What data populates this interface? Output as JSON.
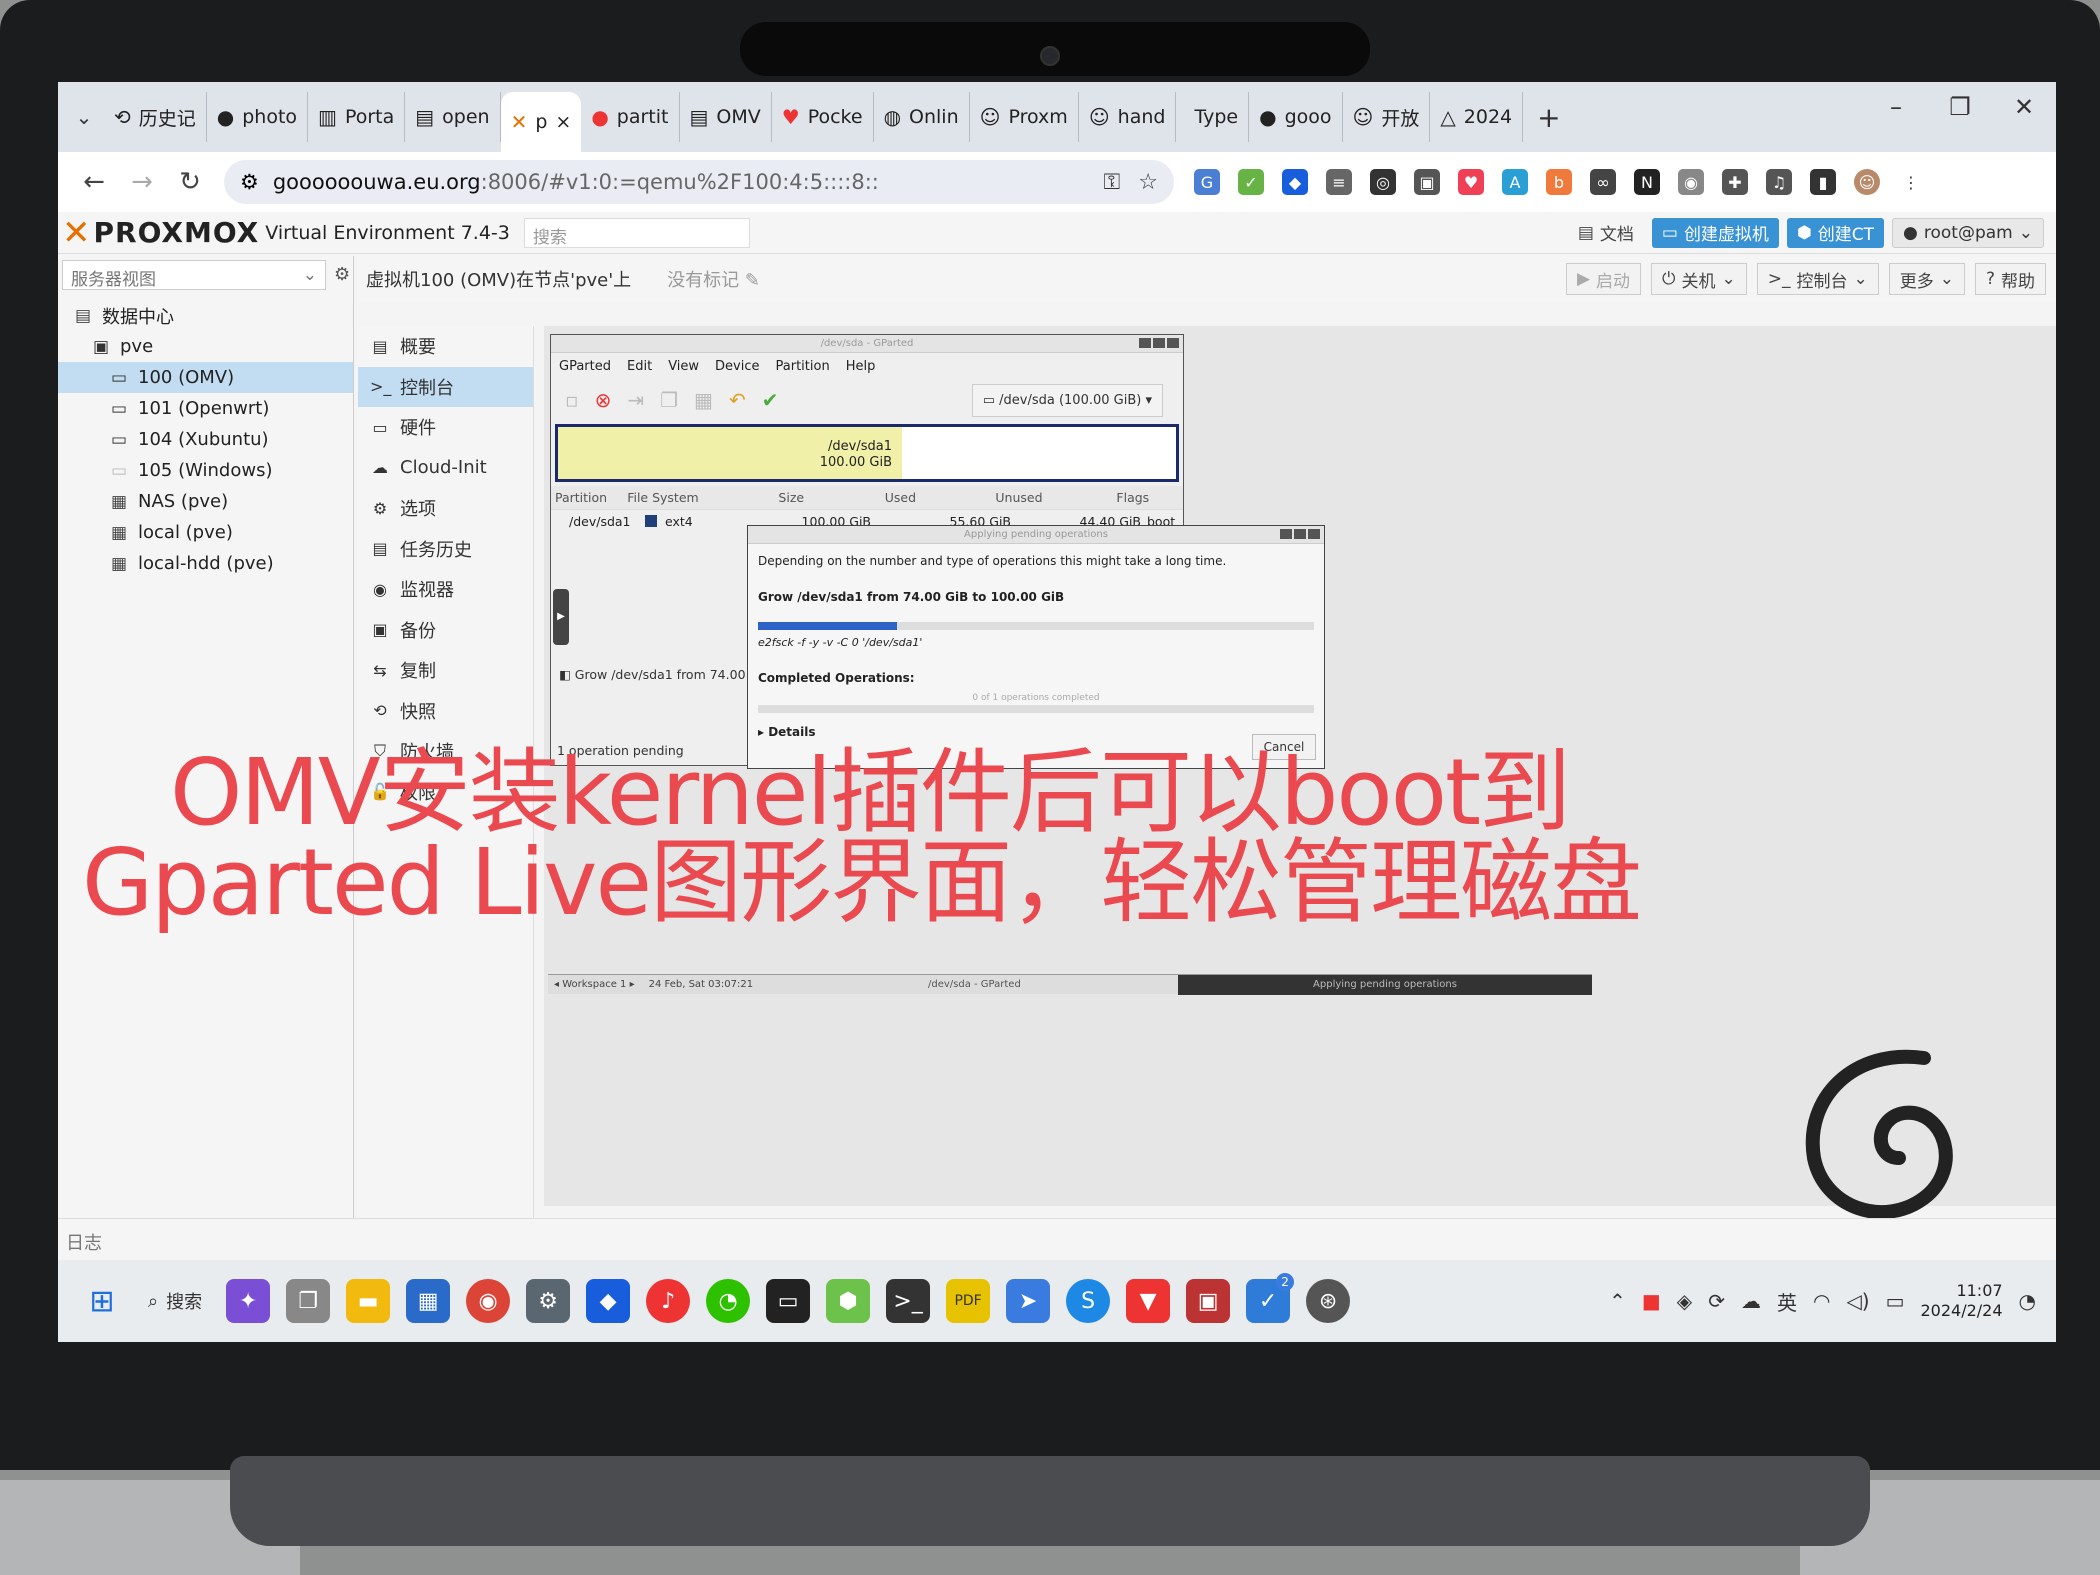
{
  "browser": {
    "tabs": [
      {
        "icon": "history-icon",
        "label": "历史记"
      },
      {
        "icon": "github-icon",
        "label": "photo"
      },
      {
        "icon": "portainer-icon",
        "label": "Porta"
      },
      {
        "icon": "doc-icon",
        "label": "open"
      },
      {
        "icon": "proxmox-icon",
        "label": "p",
        "active": true
      },
      {
        "icon": "ask-icon",
        "label": "partit"
      },
      {
        "icon": "doc-icon",
        "label": "OMV"
      },
      {
        "icon": "pocket-icon",
        "label": "Pocke"
      },
      {
        "icon": "globe-icon",
        "label": "Onlin"
      },
      {
        "icon": "avatar-icon",
        "label": "Proxm"
      },
      {
        "icon": "avatar-icon",
        "label": "hand"
      },
      {
        "icon": "blank-icon",
        "label": "Type"
      },
      {
        "icon": "github-icon",
        "label": "gooo"
      },
      {
        "icon": "avatar-icon",
        "label": "开放"
      },
      {
        "icon": "triangle-icon",
        "label": "2024"
      }
    ],
    "tab_close": "×",
    "new_tab": "+",
    "url_host": "goooooouwa.eu.org",
    "url_rest": ":8006/#v1:0:=qemu%2F100:4:5::::8::"
  },
  "pve": {
    "logo": "PROXMOX",
    "version": "Virtual Environment 7.4-3",
    "search_placeholder": "搜索",
    "header_buttons": {
      "docs": "文档",
      "create_vm": "创建虚拟机",
      "create_ct": "创建CT",
      "user": "root@pam"
    },
    "view_selector": "服务器视图",
    "tree": [
      {
        "label": "数据中心",
        "level": 0,
        "icon": "datacenter-icon"
      },
      {
        "label": "pve",
        "level": 1,
        "icon": "node-icon"
      },
      {
        "label": "100 (OMV)",
        "level": 2,
        "icon": "vm-icon",
        "selected": true
      },
      {
        "label": "101 (Openwrt)",
        "level": 2,
        "icon": "vm-icon"
      },
      {
        "label": "104 (Xubuntu)",
        "level": 2,
        "icon": "vm-icon"
      },
      {
        "label": "105 (Windows)",
        "level": 2,
        "icon": "vm-off-icon"
      },
      {
        "label": "NAS (pve)",
        "level": 2,
        "icon": "storage-icon"
      },
      {
        "label": "local (pve)",
        "level": 2,
        "icon": "storage-icon"
      },
      {
        "label": "local-hdd (pve)",
        "level": 2,
        "icon": "storage-icon"
      }
    ],
    "vm_title": "虚拟机100 (OMV)在节点'pve'上",
    "tag_placeholder": "没有标记",
    "vm_buttons": {
      "start": "启动",
      "shutdown": "关机",
      "console": "控制台",
      "more": "更多",
      "help": "帮助"
    },
    "vm_nav": [
      {
        "label": "概要",
        "icon": "summary-icon"
      },
      {
        "label": "控制台",
        "icon": "console-icon",
        "selected": true
      },
      {
        "label": "硬件",
        "icon": "hardware-icon"
      },
      {
        "label": "Cloud-Init",
        "icon": "cloud-icon"
      },
      {
        "label": "选项",
        "icon": "options-icon"
      },
      {
        "label": "任务历史",
        "icon": "task-icon"
      },
      {
        "label": "监视器",
        "icon": "monitor-icon"
      },
      {
        "label": "备份",
        "icon": "backup-icon"
      },
      {
        "label": "复制",
        "icon": "replication-icon"
      },
      {
        "label": "快照",
        "icon": "snapshot-icon"
      },
      {
        "label": "防火墙",
        "icon": "firewall-icon"
      },
      {
        "label": "权限",
        "icon": "permissions-icon"
      }
    ],
    "log_label": "日志"
  },
  "gparted": {
    "title": "/dev/sda - GParted",
    "menu": [
      "GParted",
      "Edit",
      "View",
      "Device",
      "Partition",
      "Help"
    ],
    "device": "/dev/sda (100.00 GiB)",
    "map_label": "/dev/sda1",
    "map_size": "100.00 GiB",
    "columns": [
      "Partition",
      "File System",
      "Size",
      "Used",
      "Unused",
      "Flags"
    ],
    "row": {
      "partition": "/dev/sda1",
      "fs": "ext4",
      "size": "100.00 GiB",
      "used": "55.60 GiB",
      "unused": "44.40 GiB",
      "flags": "boot"
    },
    "pending_op": "Grow /dev/sda1 from 74.00 GiB to",
    "status": "1 operation pending",
    "dialog": {
      "title": "Applying pending operations",
      "intro": "Depending on the number and type of operations this might take a long time.",
      "operation": "Grow /dev/sda1 from 74.00 GiB to 100.00 GiB",
      "progress": 0.25,
      "command": "e2fsck -f -y -v -C 0 '/dev/sda1'",
      "completed_label": "Completed Operations:",
      "completed_text": "0 of 1 operations completed",
      "details": "Details",
      "cancel": "Cancel"
    },
    "taskbar": {
      "workspace": "Workspace 1",
      "datetime": "24 Feb, Sat 03:07:21",
      "window1": "/dev/sda - GParted",
      "window2": "Applying pending operations"
    }
  },
  "overlay": {
    "line1": "OMV安装kernel插件后可以boot到",
    "line2": "Gparted Live图形界面，轻松管理磁盘"
  },
  "windows": {
    "search_label": "搜索",
    "ime": "英",
    "time": "11:07",
    "date": "2024/2/24",
    "badge": "2"
  }
}
